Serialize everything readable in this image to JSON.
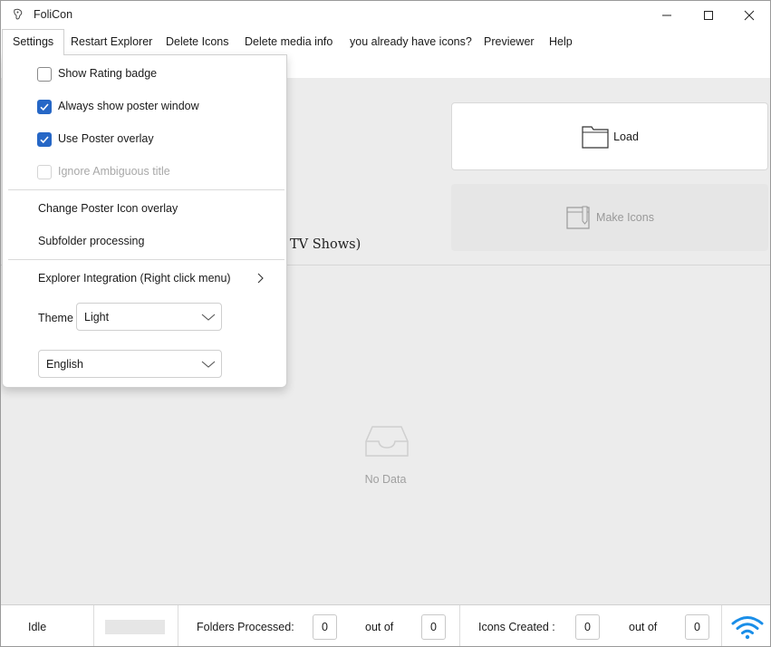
{
  "window": {
    "title": "FoliCon",
    "controls": [
      "minimize-icon",
      "maximize-icon",
      "close-icon"
    ]
  },
  "menu": {
    "items": [
      "Settings",
      "Restart Explorer",
      "Delete Icons",
      "Delete media info",
      "you already have icons?",
      "Previewer",
      "Help"
    ],
    "open_item": "Settings"
  },
  "settings_menu": {
    "show_rating_badge": {
      "label": "Show Rating badge",
      "checked": false
    },
    "always_show_poster_window": {
      "label": "Always show poster window",
      "checked": true
    },
    "use_poster_overlay": {
      "label": "Use Poster overlay",
      "checked": true
    },
    "ignore_ambiguous_title": {
      "label": "Ignore Ambiguous title",
      "checked": false,
      "disabled": true
    },
    "change_poster_icon_overlay": "Change Poster Icon overlay",
    "subfolder_processing": "Subfolder processing",
    "explorer_integration": "Explorer Integration (Right click menu)",
    "theme_label": "Theme",
    "theme_value": "Light",
    "language_value": "English"
  },
  "main": {
    "load_label": "Load",
    "make_icons_label": "Make Icons",
    "mode_label": "TV Shows)",
    "empty_text": "No Data"
  },
  "status": {
    "state": "Idle",
    "folders_processed_label": "Folders Processed:",
    "folders_processed": "0",
    "folders_out_of_label": "out of",
    "folders_total": "0",
    "icons_created_label": "Icons Created :",
    "icons_created": "0",
    "icons_out_of_label": "out of",
    "icons_total": "0",
    "connection_icon": "wifi-icon"
  },
  "colors": {
    "accent": "#2667c6",
    "wifi": "#1a8ee8",
    "background": "#ececec"
  }
}
